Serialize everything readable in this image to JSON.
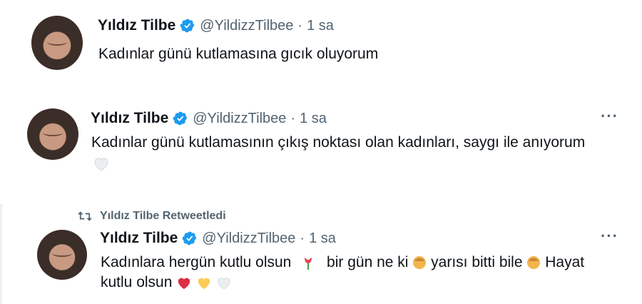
{
  "tweets": [
    {
      "name": "Yıldız Tilbe",
      "handle": "@YildizzTilbee",
      "dot": "·",
      "time": "1 sa",
      "text": "Kadınlar günü kutlamasına gıcık oluyorum"
    },
    {
      "name": "Yıldız Tilbe",
      "handle": "@YildizzTilbee",
      "dot": "·",
      "time": "1 sa",
      "text": "Kadınlar günü kutlamasının çıkış noktası olan kadınları, saygı ile anıyorum",
      "more": "···"
    },
    {
      "retweet_label": "Yıldız Tilbe Retweetledi",
      "name": "Yıldız Tilbe",
      "handle": "@YildizzTilbee",
      "dot": "·",
      "time": "1 sa",
      "text_part1": "Kadınlara hergün kutlu olsun",
      "text_part2": "bir gün ne ki",
      "text_part3": "yarısı bitti bile",
      "text_part4": "Hayat",
      "text_line2": "kutlu olsun",
      "more": "···"
    }
  ],
  "colors": {
    "verified": "#1d9bf0",
    "secondary_text": "#536471",
    "primary_text": "#0f1419"
  }
}
